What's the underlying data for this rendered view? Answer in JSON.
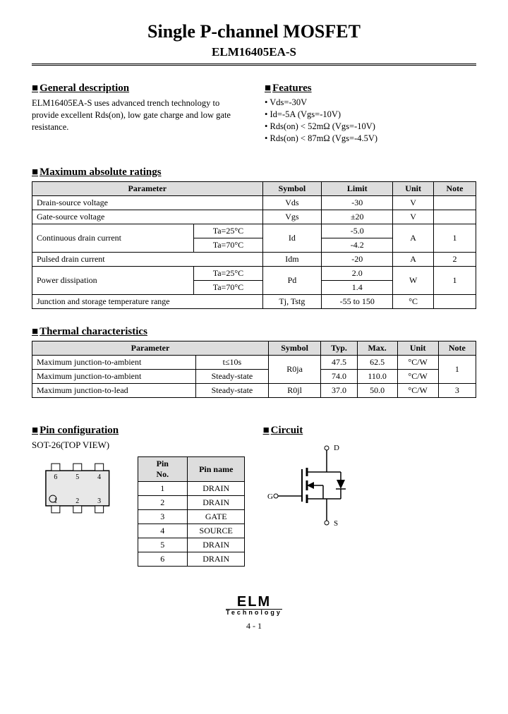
{
  "title": "Single P-channel MOSFET",
  "part_number": "ELM16405EA-S",
  "general": {
    "heading": "General description",
    "text": "ELM16405EA-S uses advanced trench technology to provide excellent Rds(on), low gate charge and low gate resistance."
  },
  "features": {
    "heading": "Features",
    "items": [
      "Vds=-30V",
      "Id=-5A (Vgs=-10V)",
      "Rds(on) < 52mΩ (Vgs=-10V)",
      "Rds(on) < 87mΩ (Vgs=-4.5V)"
    ]
  },
  "max_ratings": {
    "heading": "Maximum absolute ratings",
    "headers": [
      "Parameter",
      "Symbol",
      "Limit",
      "Unit",
      "Note"
    ],
    "rows": [
      {
        "param": "Drain-source voltage",
        "cond": "",
        "symbol": "Vds",
        "limit": "-30",
        "unit": "V",
        "note": ""
      },
      {
        "param": "Gate-source voltage",
        "cond": "",
        "symbol": "Vgs",
        "limit": "±20",
        "unit": "V",
        "note": ""
      },
      {
        "param": "Continuous drain current",
        "cond": "Ta=25°C",
        "symbol": "Id",
        "limit": "-5.0",
        "unit": "A",
        "note": "1",
        "rowspan_param": 2,
        "rowspan_sym": 2,
        "rowspan_unit": 2,
        "rowspan_note": 2
      },
      {
        "param": "",
        "cond": "Ta=70°C",
        "symbol": "",
        "limit": "-4.2",
        "unit": "",
        "note": ""
      },
      {
        "param": "Pulsed drain current",
        "cond": "",
        "symbol": "Idm",
        "limit": "-20",
        "unit": "A",
        "note": "2"
      },
      {
        "param": "Power dissipation",
        "cond": "Ta=25°C",
        "symbol": "Pd",
        "limit": "2.0",
        "unit": "W",
        "note": "1",
        "rowspan_param": 2,
        "rowspan_sym": 2,
        "rowspan_unit": 2,
        "rowspan_note": 2
      },
      {
        "param": "",
        "cond": "Ta=70°C",
        "symbol": "",
        "limit": "1.4",
        "unit": "",
        "note": ""
      },
      {
        "param": "Junction and storage temperature range",
        "cond": "",
        "symbol": "Tj, Tstg",
        "limit": "-55 to 150",
        "unit": "°C",
        "note": ""
      }
    ]
  },
  "thermal": {
    "heading": "Thermal characteristics",
    "headers": [
      "Parameter",
      "",
      "Symbol",
      "Typ.",
      "Max.",
      "Unit",
      "Note"
    ],
    "rows": [
      {
        "param": "Maximum junction-to-ambient",
        "cond": "t≤10s",
        "symbol": "R0ja",
        "typ": "47.5",
        "max": "62.5",
        "unit": "°C/W",
        "note": "1",
        "rowspan_sym": 2,
        "rowspan_note": 2
      },
      {
        "param": "Maximum junction-to-ambient",
        "cond": "Steady-state",
        "symbol": "",
        "typ": "74.0",
        "max": "110.0",
        "unit": "°C/W",
        "note": ""
      },
      {
        "param": "Maximum junction-to-lead",
        "cond": "Steady-state",
        "symbol": "R0jl",
        "typ": "37.0",
        "max": "50.0",
        "unit": "°C/W",
        "note": "3"
      }
    ]
  },
  "pin_config": {
    "heading": "Pin configuration",
    "package_label": "SOT-26(TOP VIEW)",
    "headers": [
      "Pin No.",
      "Pin name"
    ],
    "pins": [
      {
        "no": "1",
        "name": "DRAIN"
      },
      {
        "no": "2",
        "name": "DRAIN"
      },
      {
        "no": "3",
        "name": "GATE"
      },
      {
        "no": "4",
        "name": "SOURCE"
      },
      {
        "no": "5",
        "name": "DRAIN"
      },
      {
        "no": "6",
        "name": "DRAIN"
      }
    ],
    "pkg_pins": [
      "1",
      "2",
      "3",
      "4",
      "5",
      "6"
    ]
  },
  "circuit": {
    "heading": "Circuit",
    "labels": {
      "d": "D",
      "g": "G",
      "s": "S"
    }
  },
  "footer": {
    "logo_text": "ELM",
    "logo_sub": "Technology",
    "page": "4 - 1"
  }
}
